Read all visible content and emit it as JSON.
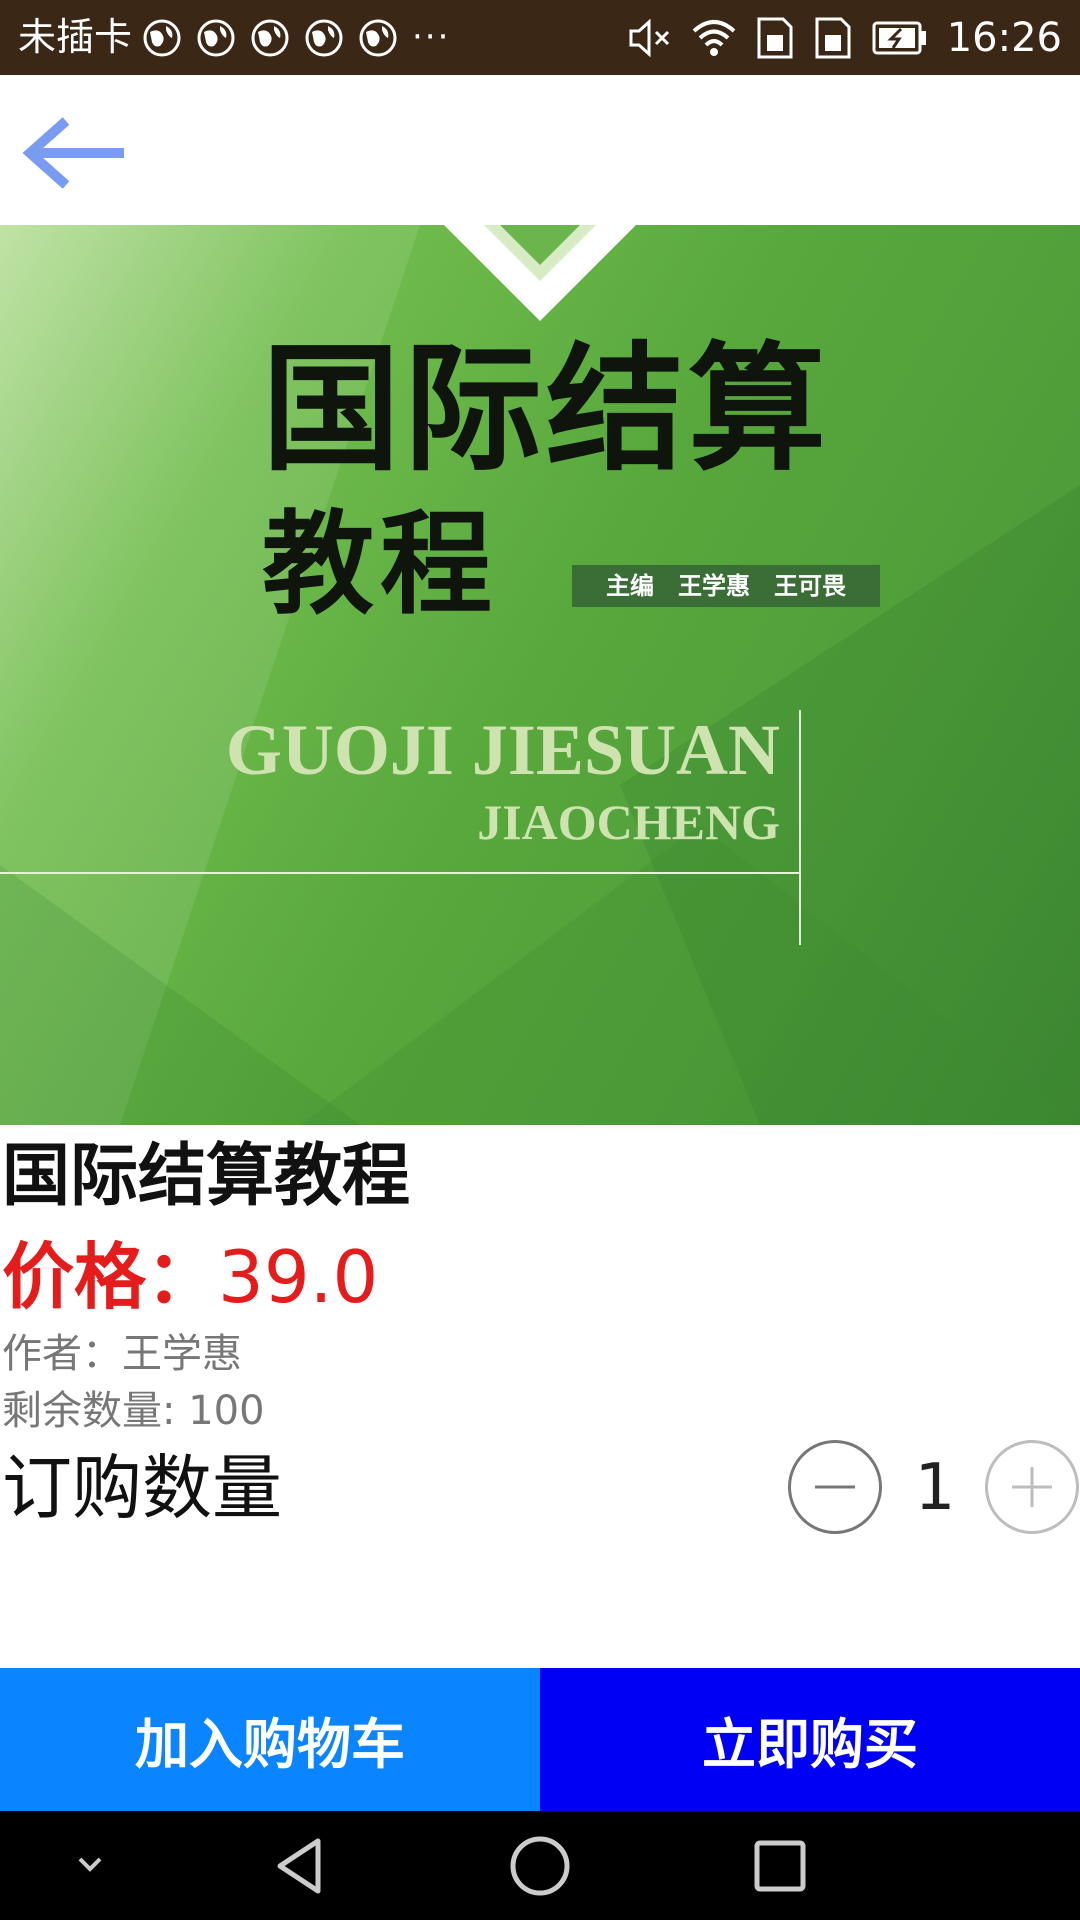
{
  "status_bar": {
    "carrier": "未插卡",
    "overflow": "···",
    "time": "16:26",
    "icons": [
      "globe-icon",
      "globe-icon",
      "globe-icon",
      "globe-icon",
      "globe-icon",
      "mute-icon",
      "wifi-icon",
      "sim-icon",
      "sim-icon",
      "battery-icon"
    ]
  },
  "app_bar": {
    "back_icon": "arrow-left-icon",
    "accent_color": "#7a9cf0"
  },
  "cover": {
    "title": "国际结算",
    "subtitle": "教程",
    "editors": "主编　王学惠　王可畏",
    "pinyin_line1": "GUOJI JIESUAN",
    "pinyin_line2": "JIAOCHENG",
    "background_color": "#5aa83e"
  },
  "product": {
    "title": "国际结算教程",
    "price_label": "价格：",
    "price_value": "39.0",
    "price_color": "#e51c1c",
    "author": "作者：王学惠",
    "stock": "剩余数量: 100",
    "quantity_label": "订购数量",
    "quantity_value": "1",
    "minus_icon": "minus-circle-icon",
    "plus_icon": "plus-circle-icon"
  },
  "actions": {
    "add_to_cart": "加入购物车",
    "buy_now": "立即购买",
    "add_to_cart_color": "#0a84ff",
    "buy_now_color": "#0000f5"
  },
  "nav_bar": {
    "icons": [
      "chevron-down-icon",
      "back-triangle-icon",
      "home-circle-icon",
      "recents-square-icon"
    ]
  }
}
